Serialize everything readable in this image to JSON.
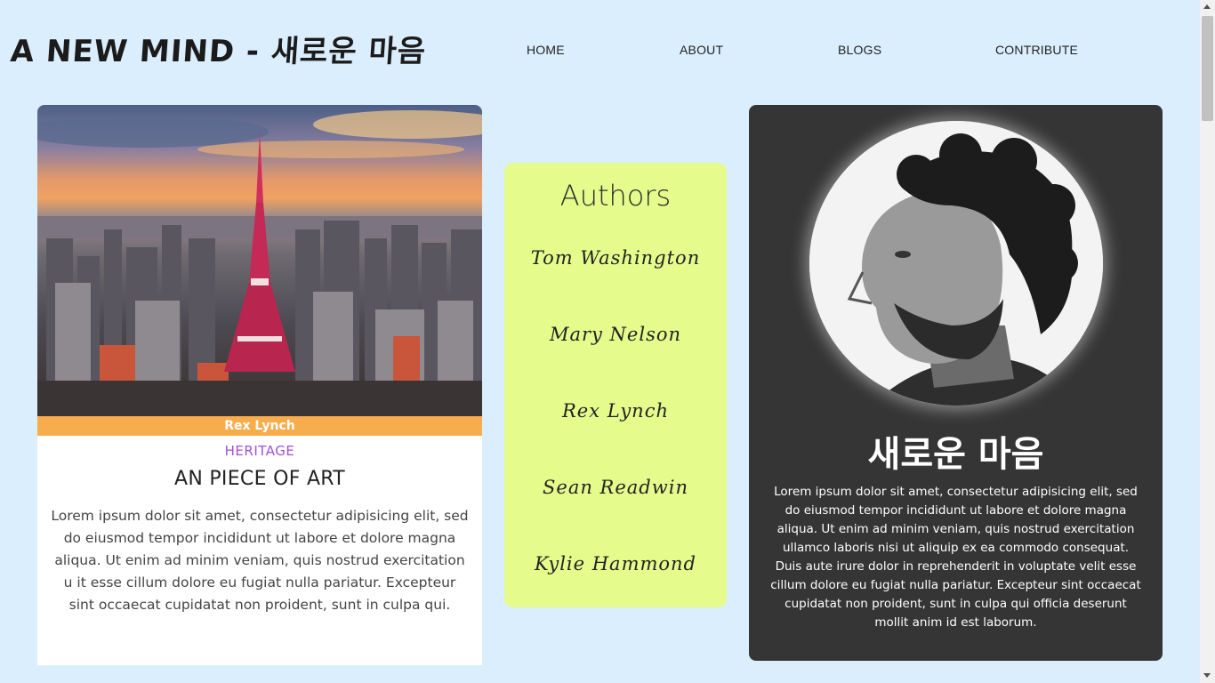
{
  "header": {
    "logo": "A NEW MIND - 새로운 마음",
    "nav": [
      "HOME",
      "ABOUT",
      "BLOGS",
      "CONTRIBUTE"
    ]
  },
  "blog_card": {
    "image_icon": "city-tower-photo",
    "author": "Rex Lynch",
    "category": "HERITAGE",
    "title": "AN PIECE OF ART",
    "body": "Lorem ipsum dolor sit amet, consectetur adipisicing elit, sed do eiusmod tempor incididunt ut labore et dolore magna aliqua. Ut enim ad minim veniam, quis nostrud exercitation u it esse cillum dolore eu fugiat nulla pariatur. Excepteur sint occaecat cupidatat non proident, sunt in culpa qui."
  },
  "authors": {
    "title": "Authors",
    "names": [
      "Tom Washington",
      "Mary Nelson",
      "Rex Lynch",
      "Sean Readwin",
      "Kylie Hammond"
    ]
  },
  "profile_card": {
    "image_icon": "portrait-photo",
    "title": "새로운 마음",
    "body": "Lorem ipsum dolor sit amet, consectetur adipisicing elit, sed do eiusmod tempor incididunt ut labore et dolore magna aliqua. Ut enim ad minim veniam, quis nostrud exercitation ullamco laboris nisi ut aliquip ex ea commodo consequat. Duis aute irure dolor in reprehenderit in voluptate velit esse cillum dolore eu fugiat nulla pariatur. Excepteur sint occaecat cupidatat non proident, sunt in culpa qui officia deserunt mollit anim id est laborum."
  },
  "colors": {
    "page_bg": "#daeefd",
    "author_strip": "#f8ad4c",
    "category": "#a04ee0",
    "authors_bg": "#e5fc8c",
    "profile_bg": "#353535"
  }
}
